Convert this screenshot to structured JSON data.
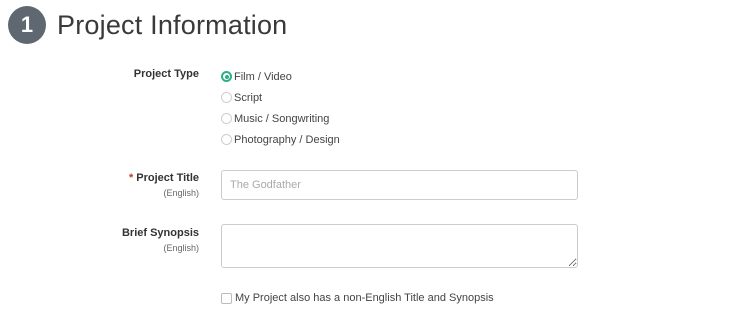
{
  "header": {
    "step_number": "1",
    "title": "Project Information"
  },
  "project_type": {
    "label": "Project Type",
    "options": [
      {
        "label": "Film / Video",
        "checked": true
      },
      {
        "label": "Script",
        "checked": false
      },
      {
        "label": "Music / Songwriting",
        "checked": false
      },
      {
        "label": "Photography / Design",
        "checked": false
      }
    ]
  },
  "project_title": {
    "required_mark": "*",
    "label": "Project Title",
    "sublabel": "(English)",
    "placeholder": "The Godfather",
    "value": ""
  },
  "brief_synopsis": {
    "label": "Brief Synopsis",
    "sublabel": "(English)",
    "value": ""
  },
  "non_english": {
    "label": "My Project also has a non-English Title and Synopsis",
    "checked": false
  },
  "colors": {
    "accent_green": "#2bb089",
    "badge_gray": "#5f6870",
    "required_red": "#c0392b"
  }
}
